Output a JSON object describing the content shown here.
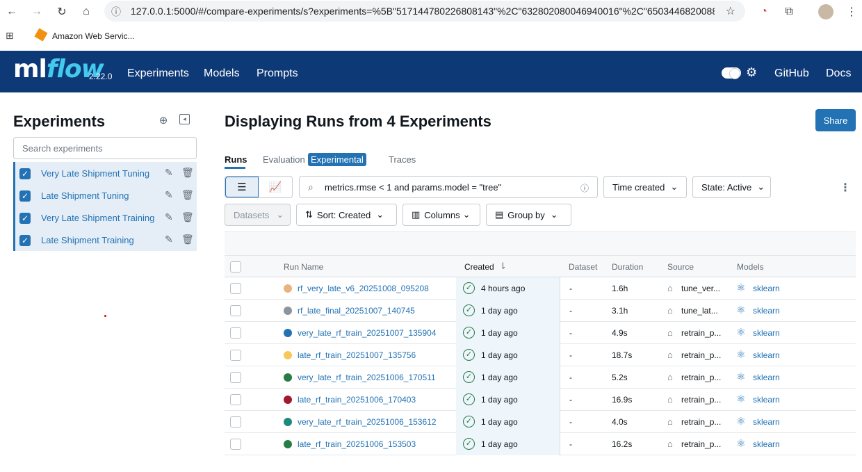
{
  "browser": {
    "url": "127.0.0.1:5000/#/compare-experiments/s?experiments=%5B\"517144780226808143\"%2C\"632802080046940016\"%2C\"6503446820088...",
    "bookmark": "Amazon Web Servic..."
  },
  "header": {
    "logo_ml": "ml",
    "logo_flow": "flow",
    "version": "2.22.0",
    "nav": [
      "Experiments",
      "Models",
      "Prompts"
    ],
    "github": "GitHub",
    "docs": "Docs"
  },
  "sidebar": {
    "title": "Experiments",
    "search_placeholder": "Search experiments",
    "experiments": [
      {
        "label": "Very Late Shipment Tuning"
      },
      {
        "label": "Late Shipment Tuning"
      },
      {
        "label": "Very Late Shipment Training"
      },
      {
        "label": "Late Shipment Training"
      }
    ]
  },
  "main": {
    "title": "Displaying Runs from 4 Experiments",
    "share": "Share",
    "tabs": [
      "Runs",
      "Evaluation",
      "Traces"
    ],
    "experimental_badge": "Experimental",
    "filter_value": "metrics.rmse < 1 and params.model = \"tree\"",
    "time_created": "Time created",
    "state": "State: Active",
    "datasets": "Datasets",
    "sort": "Sort: Created",
    "columns": "Columns",
    "group_by": "Group by"
  },
  "table": {
    "headers": {
      "run_name": "Run Name",
      "created": "Created",
      "dataset": "Dataset",
      "duration": "Duration",
      "source": "Source",
      "models": "Models"
    },
    "colors": {
      "orange": "#e8b37e",
      "gray": "#8a95a0",
      "blue": "#2272b4",
      "yellow": "#f5c85a",
      "green": "#277c43",
      "red": "#a0192e",
      "teal": "#1e8a7e"
    },
    "rows": [
      {
        "name": "rf_very_late_v6_20251008_095208",
        "dot": "#e8b37e",
        "created": "4 hours ago",
        "dataset": "-",
        "duration": "1.6h",
        "source": "tune_ver...",
        "model": "sklearn"
      },
      {
        "name": "rf_late_final_20251007_140745",
        "dot": "#8a95a0",
        "created": "1 day ago",
        "dataset": "-",
        "duration": "3.1h",
        "source": "tune_lat...",
        "model": "sklearn"
      },
      {
        "name": "very_late_rf_train_20251007_135904",
        "dot": "#2272b4",
        "created": "1 day ago",
        "dataset": "-",
        "duration": "4.9s",
        "source": "retrain_p...",
        "model": "sklearn"
      },
      {
        "name": "late_rf_train_20251007_135756",
        "dot": "#f5c85a",
        "created": "1 day ago",
        "dataset": "-",
        "duration": "18.7s",
        "source": "retrain_p...",
        "model": "sklearn"
      },
      {
        "name": "very_late_rf_train_20251006_170511",
        "dot": "#277c43",
        "created": "1 day ago",
        "dataset": "-",
        "duration": "5.2s",
        "source": "retrain_p...",
        "model": "sklearn"
      },
      {
        "name": "late_rf_train_20251006_170403",
        "dot": "#a0192e",
        "created": "1 day ago",
        "dataset": "-",
        "duration": "16.9s",
        "source": "retrain_p...",
        "model": "sklearn"
      },
      {
        "name": "very_late_rf_train_20251006_153612",
        "dot": "#1e8a7e",
        "created": "1 day ago",
        "dataset": "-",
        "duration": "4.0s",
        "source": "retrain_p...",
        "model": "sklearn"
      },
      {
        "name": "late_rf_train_20251006_153503",
        "dot": "#277c43",
        "created": "1 day ago",
        "dataset": "-",
        "duration": "16.2s",
        "source": "retrain_p...",
        "model": "sklearn"
      }
    ]
  }
}
